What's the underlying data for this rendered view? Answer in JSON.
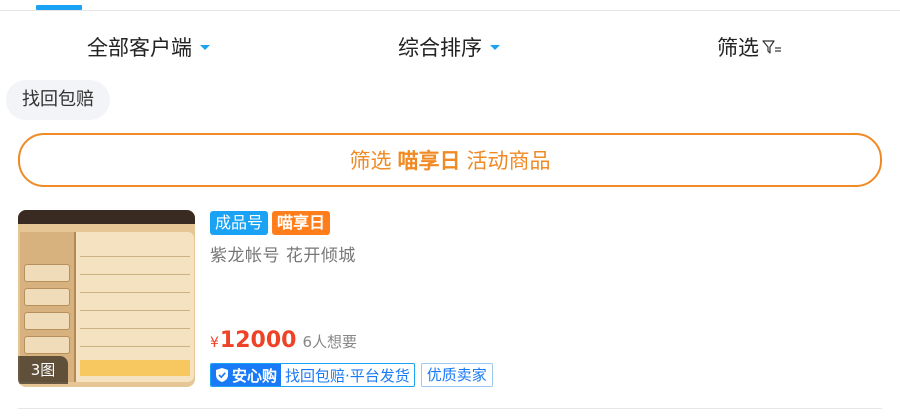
{
  "sort_bar": {
    "client_label": "全部客户端",
    "order_label": "综合排序",
    "filter_label": "筛选"
  },
  "chip": {
    "label": "找回包赔"
  },
  "banner": {
    "prefix": "筛选",
    "highlight": "喵享日",
    "suffix": "活动商品"
  },
  "product": {
    "image_count": "3图",
    "tags": [
      "成品号",
      "喵享日"
    ],
    "description": "紫龙帐号  花开倾城",
    "price_currency": "¥",
    "price_value": "12000",
    "want_count": "6人想要",
    "guarantee_label": "安心购",
    "guarantee_detail": "找回包赔·平台发货",
    "seller_badge": "优质卖家"
  },
  "colors": {
    "accent_blue": "#1aa3f5",
    "accent_orange": "#f08a24",
    "price_red": "#ee4326"
  }
}
